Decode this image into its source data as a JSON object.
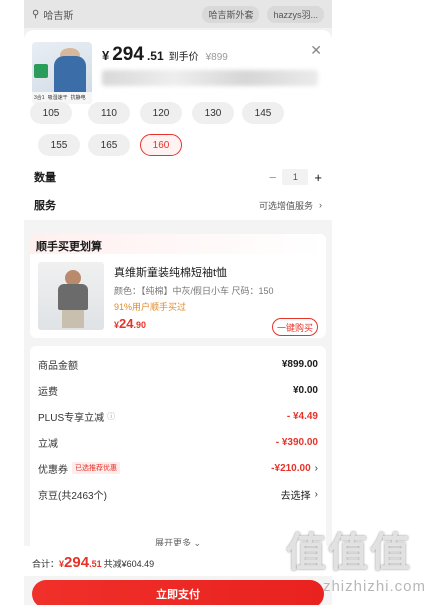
{
  "topbar": {
    "search_text": "哈吉斯",
    "chip1": "哈吉斯外套",
    "chip2": "hazzys羽..."
  },
  "product": {
    "price_currency": "¥",
    "price_int": "294",
    "price_dec": ".51",
    "price_tag": "到手价",
    "original_price": "¥899",
    "thumb_strip": [
      "3合1",
      "吸湿速干",
      "抗静电",
      "防风"
    ]
  },
  "sizes": [
    "105",
    "110",
    "120",
    "130",
    "145",
    "155",
    "165",
    "160"
  ],
  "selected_size": "160",
  "quantity": {
    "label": "数量",
    "value": "1",
    "minus": "−",
    "plus": "+"
  },
  "service": {
    "label": "服务",
    "value": "可选增值服务"
  },
  "bundle": {
    "header": "顺手买更划算",
    "title": "真维斯童装纯棉短袖t恤",
    "spec": "颜色：【纯棉】中灰/假日小车  尺码：150",
    "promo": "91%用户顺手买过",
    "price_currency": "¥",
    "price_int": "24",
    "price_dec": ".90",
    "buy_label": "一键购买"
  },
  "summary": {
    "rows": [
      {
        "label": "商品金额",
        "value": "¥899.00",
        "red": false
      },
      {
        "label": "运费",
        "value": "¥0.00",
        "red": false
      },
      {
        "label": "PLUS专享立减",
        "value": "- ¥4.49",
        "red": true
      },
      {
        "label": "立减",
        "value": "- ¥390.00",
        "red": true
      },
      {
        "label": "优惠券",
        "value": "-¥210.00",
        "red": true
      },
      {
        "label": "京豆(共2463个)",
        "value": "去选择",
        "red": false
      }
    ],
    "coupon_pill": "已选推荐优惠",
    "expand": "展开更多"
  },
  "total": {
    "label": "合计：",
    "currency": "¥",
    "int": "294",
    "dec": ".51",
    "saved": "共减¥604.49"
  },
  "pay_label": "立即支付",
  "watermark": {
    "glyphs": "值值值",
    "site": "zhizhizhi.com"
  },
  "colors": {
    "accent": "#e6332a",
    "promo": "#e08a2a"
  }
}
